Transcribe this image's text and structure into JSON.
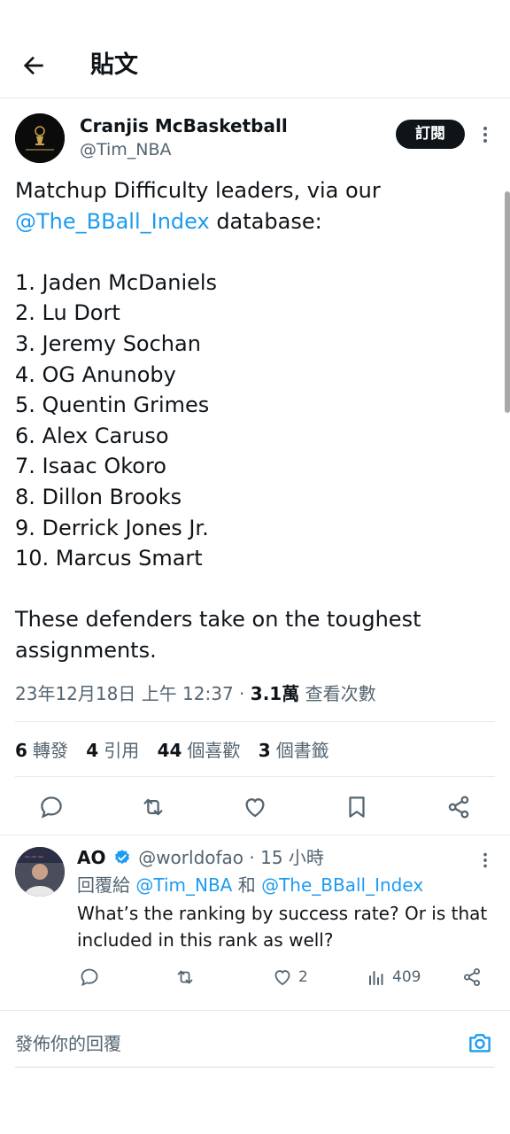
{
  "header": {
    "title": "貼文",
    "back_icon": "arrow-left-icon"
  },
  "tweet": {
    "author_name": "Cranjis McBasketball",
    "author_handle": "@Tim_NBA",
    "subscribe_label": "訂閱",
    "text_line1": "Matchup Difficulty leaders, via our",
    "mention": "@The_BBall_Index",
    "text_line2_rest": " database:",
    "list": [
      "1. Jaden McDaniels",
      "2. Lu Dort",
      "3. Jeremy Sochan",
      "4. OG Anunoby",
      "5. Quentin Grimes",
      "6. Alex Caruso",
      "7. Isaac Okoro",
      "8. Dillon Brooks",
      "9. Derrick Jones Jr.",
      "10. Marcus Smart"
    ],
    "closing_line1": "These defenders take on the toughest",
    "closing_line2": "assignments.",
    "timestamp": "23年12月18日 上午 12:37 · ",
    "views_count": "3.1萬",
    "views_label": " 查看次數",
    "stats": {
      "retweets_count": "6",
      "retweets_label": "轉發",
      "quotes_count": "4",
      "quotes_label": "引用",
      "likes_count": "44",
      "likes_label": "個喜歡",
      "bookmarks_count": "3",
      "bookmarks_label": "個書籤"
    }
  },
  "reply": {
    "name": "AO",
    "handle_time": "@worldofao · 15 小時",
    "reply_to_prefix": "回覆給 ",
    "reply_to_1": "@Tim_NBA",
    "reply_to_and": " 和 ",
    "reply_to_2": "@The_BBall_Index",
    "text": "What’s the ranking by success rate?  Or is that included in this rank as well?",
    "likes": "2",
    "views": "409"
  },
  "composer": {
    "placeholder": "發佈你的回覆"
  },
  "colors": {
    "accent": "#1d9bf0",
    "text": "#0f1419",
    "muted": "#536471",
    "verified": "#1d9bf0"
  }
}
